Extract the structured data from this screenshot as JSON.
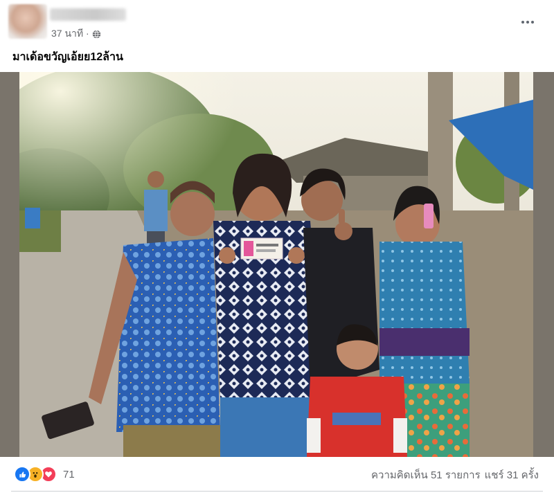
{
  "post": {
    "author_name": "",
    "timestamp": "37 นาที ·",
    "privacy_icon": "globe-icon",
    "menu_icon": "more-horizontal-icon",
    "caption": "มาเด้อขวัญเอ้ยย12ล้าน"
  },
  "photo": {
    "description_icon": "photo"
  },
  "footer": {
    "reaction_icons": [
      "like-icon",
      "wow-icon",
      "love-icon"
    ],
    "reaction_count": "71",
    "comments_text": "ความคิดเห็น 51 รายการ",
    "shares_text": "แชร์ 31 ครั้ง"
  },
  "colors": {
    "like": "#1877f2",
    "wow": "#f7b125",
    "love": "#f33e58",
    "secondary_text": "#65676b"
  }
}
